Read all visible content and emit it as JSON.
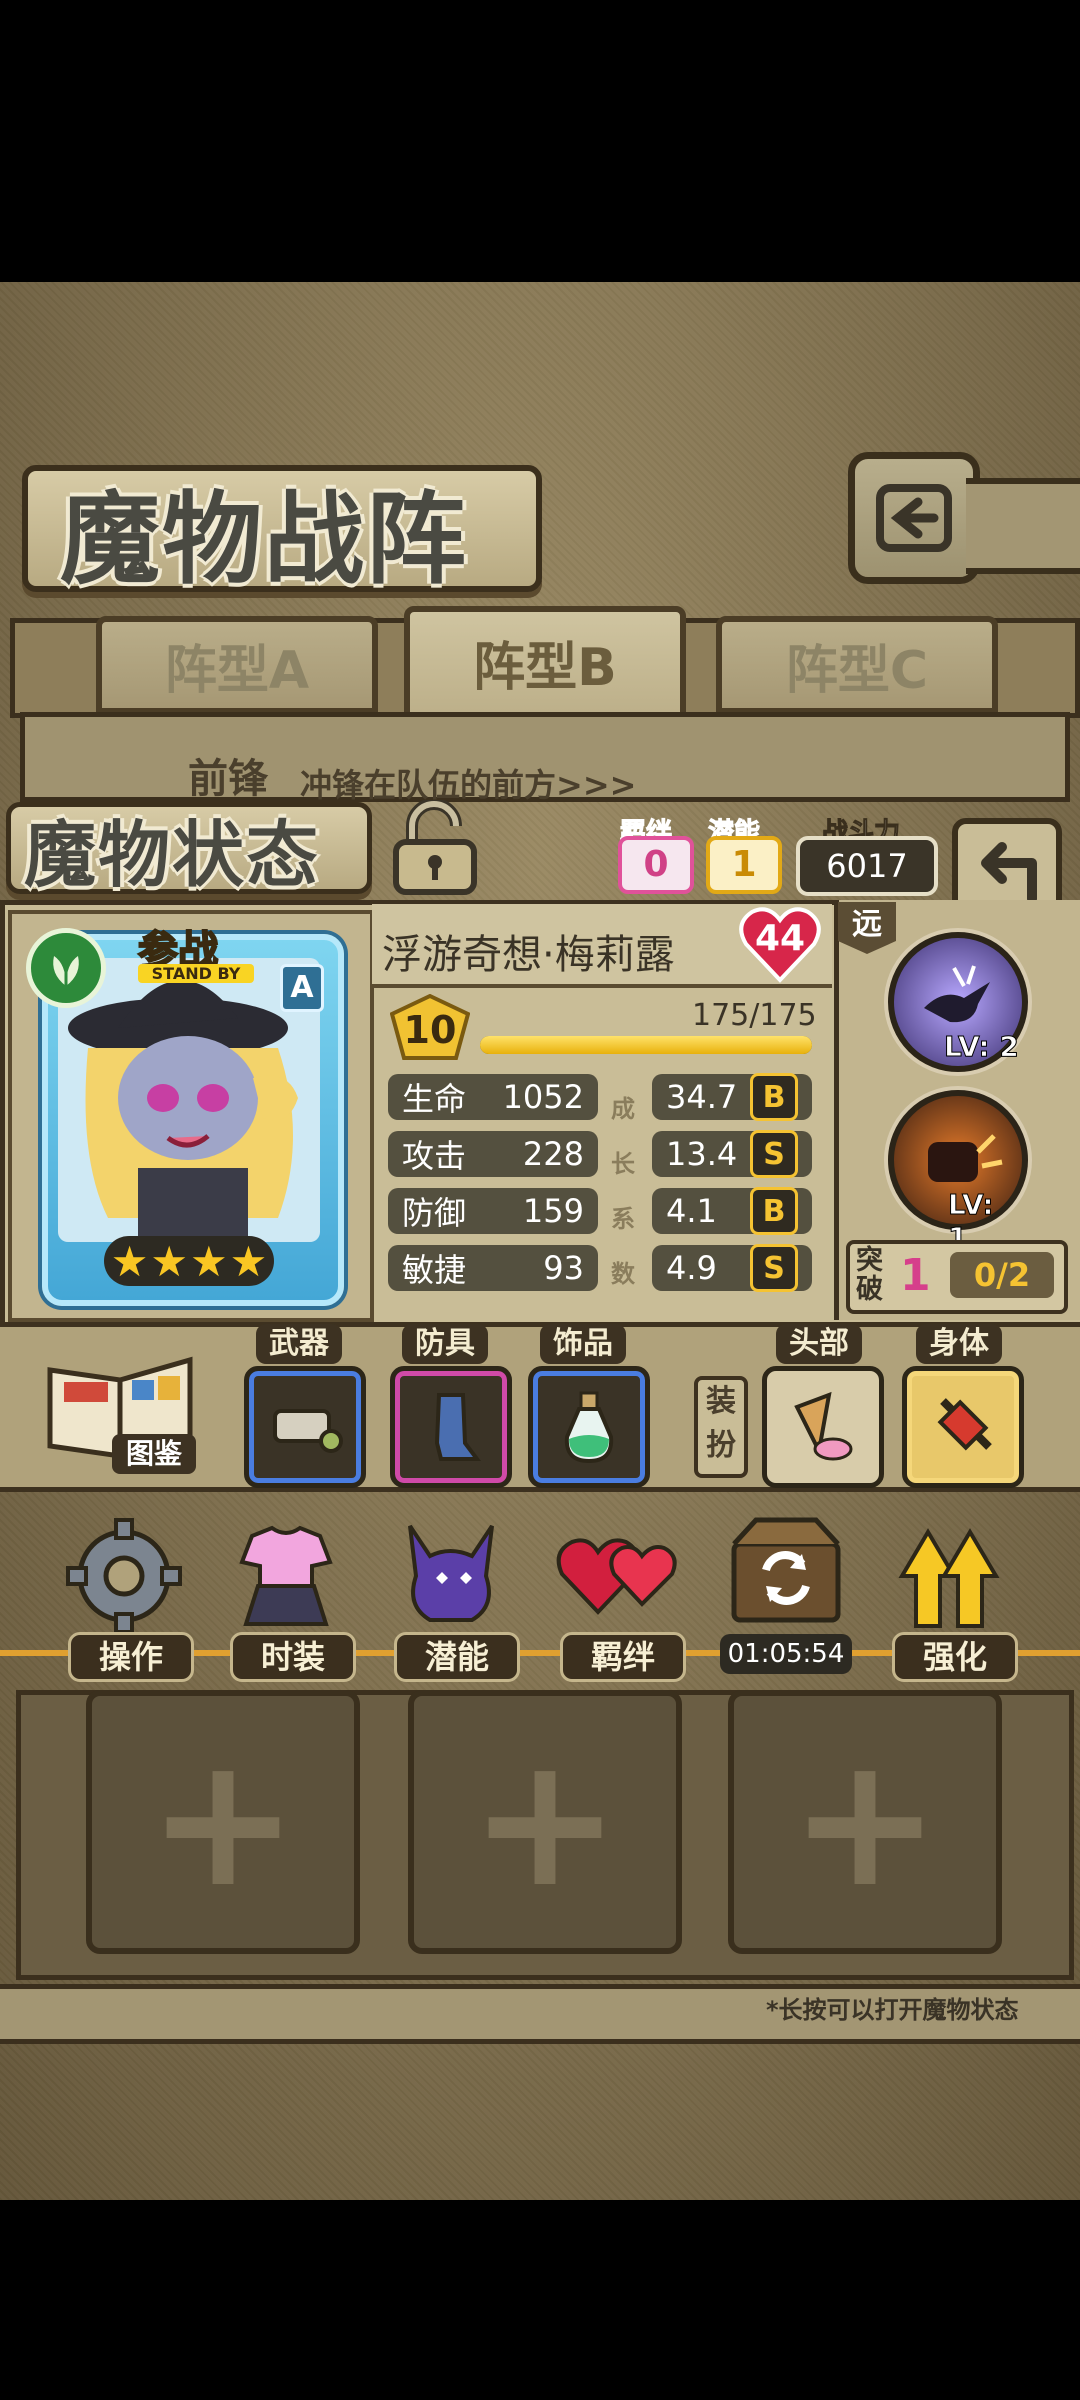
{
  "header": {
    "title": "魔物战阵",
    "back_icon": "back-arrow-icon"
  },
  "formation_tabs": [
    "阵型A",
    "阵型B",
    "阵型C"
  ],
  "vanguard": {
    "label": "前锋",
    "desc": "冲锋在队伍的前方>>>"
  },
  "status": {
    "title": "魔物状态",
    "bond_label": "羁绊",
    "bond_value": "0",
    "potential_label": "潜能",
    "potential_value": "1",
    "power_label": "战斗力",
    "power_value": "6017"
  },
  "card": {
    "badge": "参战",
    "badge_sub": "STAND BY",
    "rank": "A",
    "stars": 4,
    "element_icon": "leaf-icon"
  },
  "monster": {
    "name": "浮游奇想·梅莉露",
    "heart_level": "44",
    "level": "10",
    "exp_text": "175/175",
    "exp_fraction": 1.0
  },
  "stats": [
    {
      "label": "生命",
      "value": "1052",
      "growth": "34.7",
      "grade": "B"
    },
    {
      "label": "攻击",
      "value": "228",
      "growth": "13.4",
      "grade": "S"
    },
    {
      "label": "防御",
      "value": "159",
      "growth": "4.1",
      "grade": "B"
    },
    {
      "label": "敏捷",
      "value": "93",
      "growth": "4.9",
      "grade": "S"
    }
  ],
  "growth_vertical": [
    "成",
    "长",
    "系",
    "数"
  ],
  "skills": {
    "range_label": "远",
    "skill1_level": "LV: 2",
    "skill2_level": "LV: 1",
    "breakthrough_label": "突破",
    "breakthrough_value": "1",
    "breakthrough_progress": "0/2"
  },
  "equipment": {
    "codex_label": "图鉴",
    "weapon": "武器",
    "armor": "防具",
    "accessory": "饰品",
    "dress_label": "装扮",
    "head": "头部",
    "body": "身体"
  },
  "actions": [
    {
      "label": "操作",
      "icon": "gear-icon"
    },
    {
      "label": "时装",
      "icon": "outfit-icon"
    },
    {
      "label": "潜能",
      "icon": "demon-silhouette-icon"
    },
    {
      "label": "羁绊",
      "icon": "hearts-icon"
    },
    {
      "label": "01:05:54",
      "icon": "refresh-chest-icon"
    },
    {
      "label": "强化",
      "icon": "upgrade-arrows-icon"
    }
  ],
  "footer_hint": "*长按可以打开魔物状态",
  "colors": {
    "gold": "#f5c332",
    "pink": "#e0529a",
    "dark": "#3b2f1d"
  }
}
